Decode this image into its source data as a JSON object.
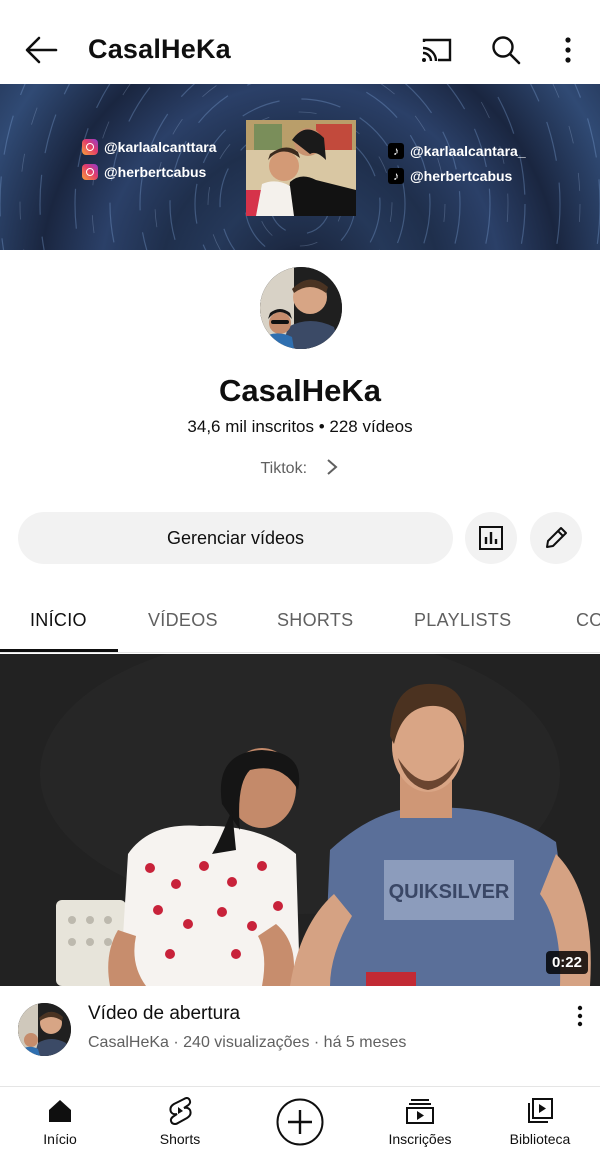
{
  "header": {
    "title": "CasalHeKa"
  },
  "banner": {
    "instagram": [
      "@karlaalcanttara",
      "@herbertcabus"
    ],
    "tiktok": [
      "@karlaalcantara_",
      "@herbertcabus"
    ]
  },
  "channel": {
    "name": "CasalHeKa",
    "stats": "34,6 mil inscritos • 228 vídeos",
    "link_label": "Tiktok:"
  },
  "actions": {
    "manage_label": "Gerenciar vídeos"
  },
  "tabs": [
    {
      "label": "INÍCIO",
      "active": true
    },
    {
      "label": "VÍDEOS"
    },
    {
      "label": "SHORTS"
    },
    {
      "label": "PLAYLISTS"
    },
    {
      "label": "CO"
    }
  ],
  "featured_video": {
    "duration": "0:22",
    "title": "Vídeo de abertura",
    "meta": "CasalHeKa · 240 visualizações · há 5 meses",
    "shirt_text": "QUIKSILVER"
  },
  "bottom_nav": [
    {
      "label": "Início",
      "icon": "home-icon"
    },
    {
      "label": "Shorts",
      "icon": "shorts-icon"
    },
    {
      "label": "",
      "icon": "create-icon"
    },
    {
      "label": "Inscrições",
      "icon": "subscriptions-icon"
    },
    {
      "label": "Biblioteca",
      "icon": "library-icon"
    }
  ]
}
